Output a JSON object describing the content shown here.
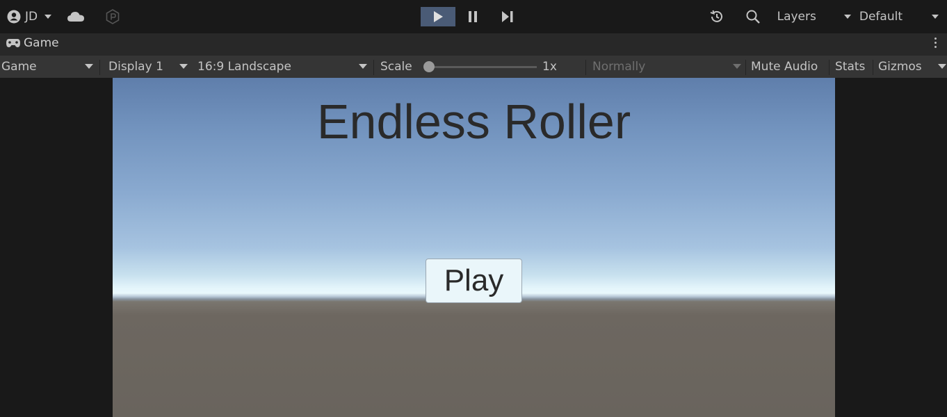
{
  "toolbar": {
    "account_label": "JD",
    "layers_label": "Layers",
    "layout_label": "Default",
    "icons": [
      "account-icon",
      "cloud-icon",
      "collab-icon",
      "play-icon",
      "pause-icon",
      "step-icon",
      "history-icon",
      "search-icon"
    ],
    "play_active": true
  },
  "tab": {
    "label": "Game"
  },
  "game_controls": {
    "view_mode": "Game",
    "display": "Display 1",
    "aspect": "16:9 Landscape",
    "scale_label": "Scale",
    "scale_value": "1x",
    "vsync": "Normally",
    "mute_audio": "Mute Audio",
    "stats": "Stats",
    "gizmos": "Gizmos"
  },
  "game": {
    "title": "Endless Roller",
    "play_button": "Play"
  },
  "colors": {
    "editor_bg": "#191919",
    "control_bar": "#353535",
    "play_active": "#4a5b76",
    "ground": "#69645d",
    "sky_top": "#5f7eab"
  }
}
